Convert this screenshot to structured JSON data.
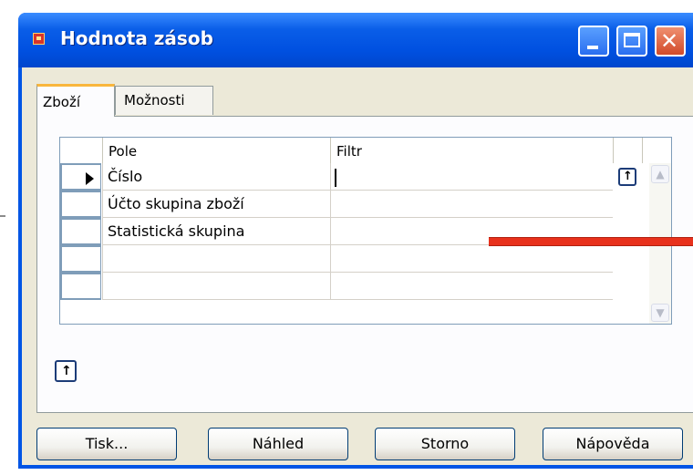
{
  "window": {
    "title": "Hodnota zásob"
  },
  "tabs": [
    {
      "label": "Zboží",
      "active": true
    },
    {
      "label": "Možnosti",
      "active": false
    }
  ],
  "grid": {
    "columns": [
      "Pole",
      "Filtr"
    ],
    "rows": [
      {
        "pole": "Číslo",
        "filtr": ""
      },
      {
        "pole": "Účto skupina zboží",
        "filtr": ""
      },
      {
        "pole": "Statistická skupina",
        "filtr": ""
      },
      {
        "pole": "",
        "filtr": ""
      },
      {
        "pole": "",
        "filtr": ""
      }
    ]
  },
  "buttons": {
    "print": "Tisk...",
    "preview": "Náhled",
    "cancel": "Storno",
    "help": "Nápověda"
  },
  "colors": {
    "titlebar": "#0055e5",
    "annotation_arrow": "#e8311c",
    "tab_highlight": "#f9b63c"
  }
}
